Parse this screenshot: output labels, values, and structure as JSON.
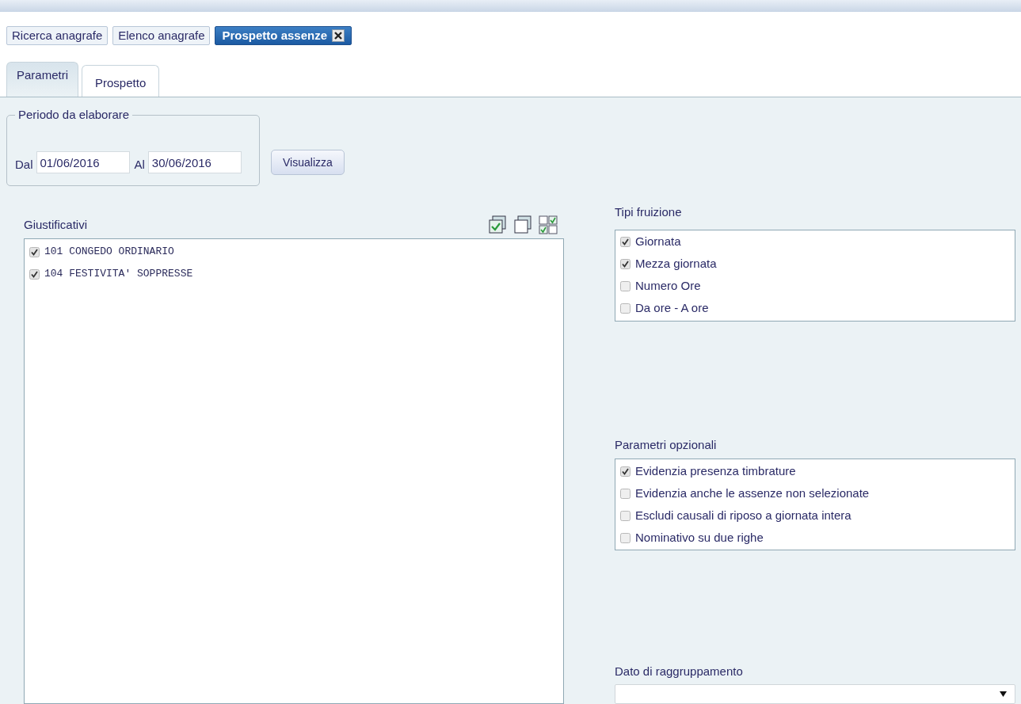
{
  "doc_tabs": [
    {
      "label": "Ricerca anagrafe",
      "selected": false
    },
    {
      "label": "Elenco anagrafe",
      "selected": false
    },
    {
      "label": "Prospetto assenze",
      "selected": true
    }
  ],
  "tabs": [
    {
      "label": "Parametri",
      "selected": true
    },
    {
      "label": "Prospetto",
      "selected": false
    }
  ],
  "period": {
    "legend": "Periodo da elaborare",
    "from_label": "Dal",
    "from_value": "01/06/2016",
    "to_label": "Al",
    "to_value": "30/06/2016",
    "button": "Visualizza"
  },
  "giustificativi": {
    "title": "Giustificativi",
    "items": [
      {
        "label": "101 CONGEDO ORDINARIO",
        "checked": true
      },
      {
        "label": "104 FESTIVITA' SOPPRESSE",
        "checked": true
      }
    ]
  },
  "tipi_fruizione": {
    "title": "Tipi fruizione",
    "items": [
      {
        "label": "Giornata",
        "checked": true
      },
      {
        "label": "Mezza giornata",
        "checked": true
      },
      {
        "label": "Numero Ore",
        "checked": false
      },
      {
        "label": "Da ore - A ore",
        "checked": false
      }
    ]
  },
  "parametri_opzionali": {
    "title": "Parametri opzionali",
    "items": [
      {
        "label": "Evidenzia presenza timbrature",
        "checked": true
      },
      {
        "label": "Evidenzia anche le assenze non selezionate",
        "checked": false
      },
      {
        "label": "Escludi causali di riposo a giornata intera",
        "checked": false
      },
      {
        "label": "Nominativo su due righe",
        "checked": false
      }
    ]
  },
  "raggruppamento": {
    "title": "Dato di raggruppamento"
  }
}
